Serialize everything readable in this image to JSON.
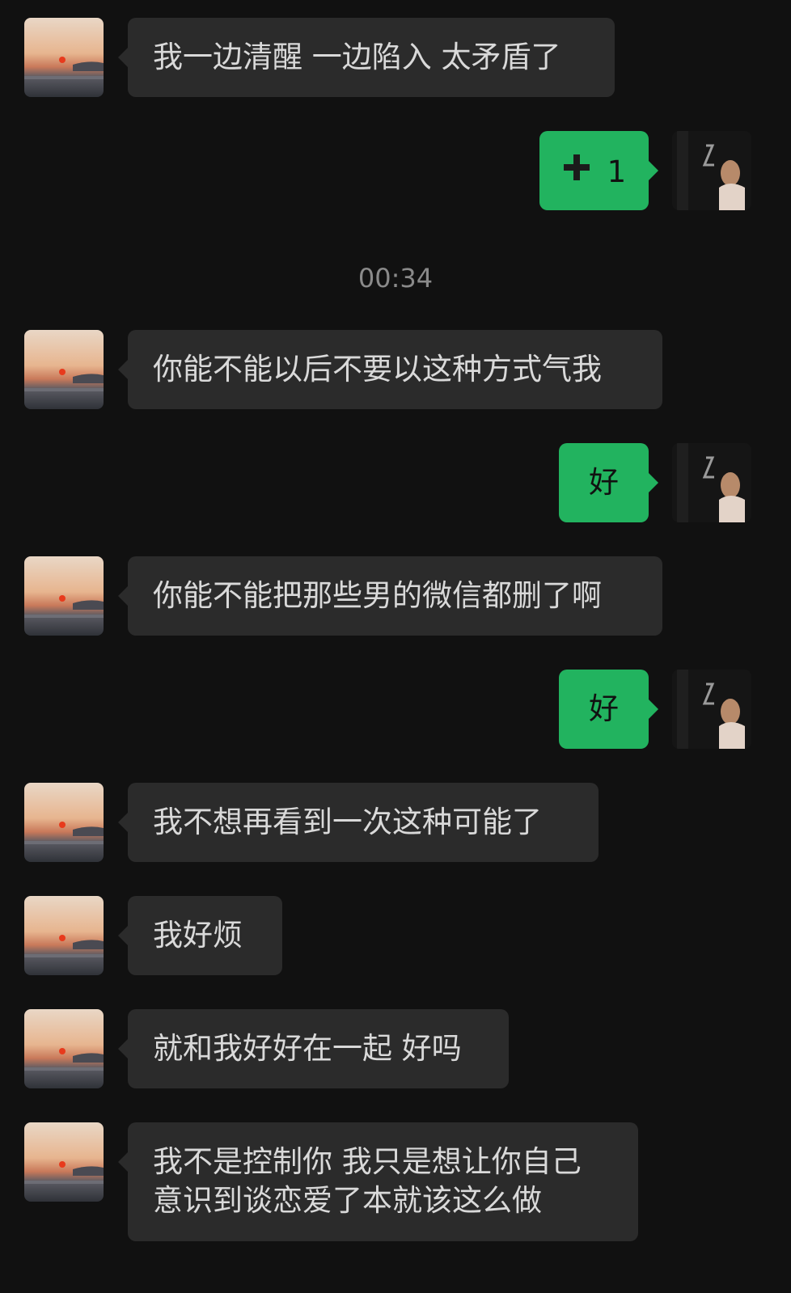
{
  "colors": {
    "background": "#111111",
    "received_bubble": "#2b2b2b",
    "sent_bubble": "#22b35f"
  },
  "timestamp": "00:34",
  "messages": [
    {
      "side": "left",
      "text": "我一边清醒 一边陷入 太矛盾了"
    },
    {
      "side": "right",
      "text": "1",
      "icon": "plus-icon"
    },
    {
      "side": "left",
      "text": "你能不能以后不要以这种方式气我"
    },
    {
      "side": "right",
      "text": "好"
    },
    {
      "side": "left",
      "text": "你能不能把那些男的微信都删了啊"
    },
    {
      "side": "right",
      "text": "好"
    },
    {
      "side": "left",
      "text": "我不想再看到一次这种可能了"
    },
    {
      "side": "left",
      "text": "我好烦"
    },
    {
      "side": "left",
      "text": "就和我好好在一起 好吗"
    },
    {
      "side": "left",
      "lines": [
        "我不是控制你 我只是想让你自己",
        "意识到谈恋爱了本就该这么做"
      ]
    }
  ]
}
